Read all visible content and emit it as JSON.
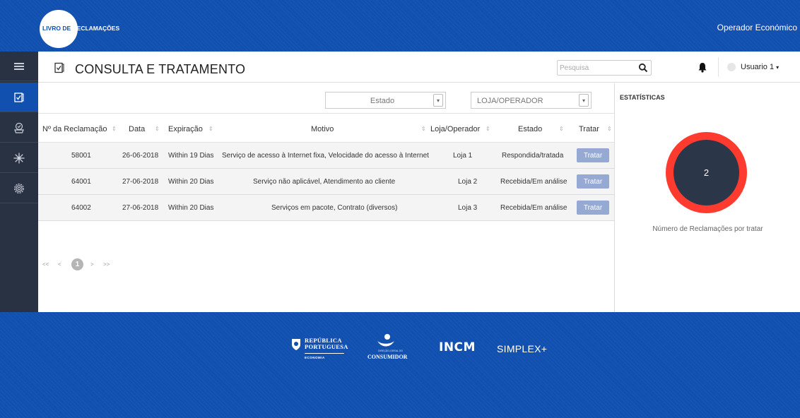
{
  "topbar": {
    "logo_part1": "LIVRO DE",
    "logo_part2": "RECLAMAÇÕES",
    "operator_label": "Operador Económico"
  },
  "header": {
    "title": "CONSULTA E TRATAMENTO",
    "search_placeholder": "Pesquisa",
    "user_label": "Usuario 1",
    "user_caret": "▾"
  },
  "sidebar": {
    "items": [
      {
        "icon": "menu-icon"
      },
      {
        "icon": "complaint-book-icon",
        "active": true
      },
      {
        "icon": "basket-icon"
      },
      {
        "icon": "snowflake-icon"
      },
      {
        "icon": "settings-icon"
      }
    ]
  },
  "filters": {
    "estado": "Estado",
    "loja": "LOJA/OPERADOR"
  },
  "table": {
    "columns": [
      "Nº da Reclamação",
      "Data",
      "Expiração",
      "Motivo",
      "Loja/Operador",
      "Estado",
      "Tratar"
    ],
    "rows": [
      {
        "id": "58001",
        "data": "26-06-2018",
        "expiracao": "Within 19 Dias",
        "motivo": "Serviço de acesso à Internet fixa, Velocidade do acesso à Internet",
        "loja": "Loja 1",
        "estado": "Respondida/tratada",
        "action": "Tratar"
      },
      {
        "id": "64001",
        "data": "27-06-2018",
        "expiracao": "Within 20 Dias",
        "motivo": "Serviço não aplicável, Atendimento ao cliente",
        "loja": "Loja 2",
        "estado": "Recebida/Em análise",
        "action": "Tratar"
      },
      {
        "id": "64002",
        "data": "27-06-2018",
        "expiracao": "Within 20 Dias",
        "motivo": "Serviços em pacote, Contrato (diversos)",
        "loja": "Loja 3",
        "estado": "Recebida/Em análise",
        "action": "Tratar"
      }
    ]
  },
  "pagination": {
    "first": "<<",
    "prev": "<",
    "current": "1",
    "next": ">",
    "last": ">>"
  },
  "stats": {
    "title": "ESTATÍSTICAS",
    "count": "2",
    "caption": "Número de Reclamações por tratar"
  },
  "footer": {
    "rp_line1": "REPÚBLICA",
    "rp_line2": "PORTUGUESA",
    "rp_sub": "ECONOMIA",
    "consumidor_sub": "DIREÇÃO-GERAL DO",
    "consumidor": "CONSUMIDOR",
    "incm": "INCM",
    "simplex": "SIMPLEX+"
  },
  "colors": {
    "brand_blue": "#1250b0",
    "sidebar_dark": "#293242",
    "donut_ring": "#ff3b30",
    "donut_center": "#2c3649",
    "button": "#95a9d3"
  }
}
